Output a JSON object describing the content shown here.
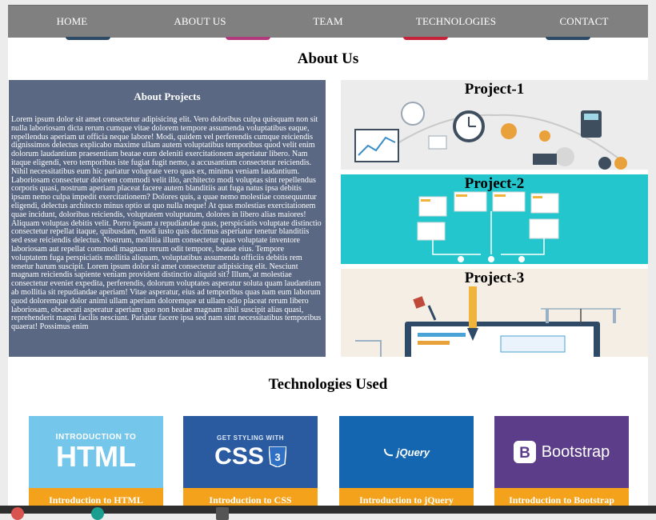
{
  "nav": {
    "items": [
      "HOME",
      "ABOUT US",
      "TEAM",
      "TECHNOLOGIES",
      "CONTACT"
    ]
  },
  "about": {
    "heading": "About Us",
    "panel_title": "About Projects",
    "text": "Lorem ipsum dolor sit amet consectetur adipisicing elit. Vero doloribus culpa quisquam non sit nulla laboriosam dicta rerum cumque vitae dolorem tempore assumenda voluptatibus eaque, repellendus aperiam ut officia neque labore! Modi, quidem vel perferendis cumque reiciendis dignissimos delectus explicabo maxime ullam autem voluptatibus temporibus quod velit enim dolorum laudantium praesentium beatae eum deleniti exercitationem asperiatur libero. Nam itaque eligendi, vero temporibus iste fugiat fugit nemo, a accusantium consectetur reiciendis. Nihil necessitatibus eum hic pariatur voluptate vero quas ex, minima veniam laudantium. Laboriosam consectetur dolorem commodi velit illo, architecto modi voluptas sint repellendus corporis quasi, nostrum aperiam placeat facere autem blanditiis aut fuga natus ipsa debitis ipsam nemo culpa impedit exercitationem? Dolores quis, a quae nemo molestiae consequuntur eligendi, delectus architecto minus optio ut quo nulla neque! At quas molestias exercitationem quae incidunt, doloribus reiciendis, voluptatem voluptatum, dolores in libero alias maiores! Aliquam voluptas debitis velit. Porro ipsum a repudiandae quas, perspiciatis voluptate distinctio consectetur repellat itaque, quibusdam, modi iusto quis ducimus asperiatur tenetur blanditiis sed esse reiciendis delectus. Nostrum, mollitia illum consectetur quas voluptate inventore laboriosam aut repellat commodi magnam rerum odit tempore, beatae eius. Tempore voluptatem fuga perspiciatis mollitia aliquam, voluptatibus assumenda officiis debitis rem tenetur harum suscipit. Lorem ipsum dolor sit amet consectetur adipisicing elit. Nesciunt magnam reiciendis sapiente veniam provident distinctio aliquid sit? Illum, at molestiae consectetur eveniet expedita, perferendis, dolorum voluptates asperatur soluta quam laudantium ab mollitia sit repudiandae aperiam! Vitae asperatur, eius ad temporibus quas nam eum laborum quod doloremque dolor animi ullam aperiam doloremque ut ullam odio placeat rerum libero laboriosam, obcaecati asperatur aperiam quo non beatae magnam nihil suscipit alias quasi, reprehenderit magni facilis nesciunt. Pariatur facere ipsa sed nam sint necessitatibus temporibus quaerat! Possimus enim"
  },
  "projects": [
    {
      "title": "Project-1"
    },
    {
      "title": "Project-2"
    },
    {
      "title": "Project-3"
    }
  ],
  "technologies": {
    "heading": "Technologies Used",
    "cards": [
      {
        "caption": "Introduction to HTML",
        "logo_small": "INTRODUCTION TO",
        "logo_big": "HTML",
        "bg": "#74c6ea"
      },
      {
        "caption": "Introduction to CSS",
        "logo_small": "GET STYLING WITH",
        "logo_big": "CSS",
        "bg": "#2a5aa0"
      },
      {
        "caption": "Introduction to jQuery",
        "logo_big": "jQuery",
        "bg": "#1566b0"
      },
      {
        "caption": "Introduction to Bootstrap",
        "logo_big": "Bootstrap",
        "bg": "#5b3d89"
      }
    ]
  },
  "colors": {
    "nav_bg": "#808080",
    "about_panel": "#5a6883",
    "caption_bar": "#f4a21b",
    "project2_bg": "#23c6cc"
  }
}
